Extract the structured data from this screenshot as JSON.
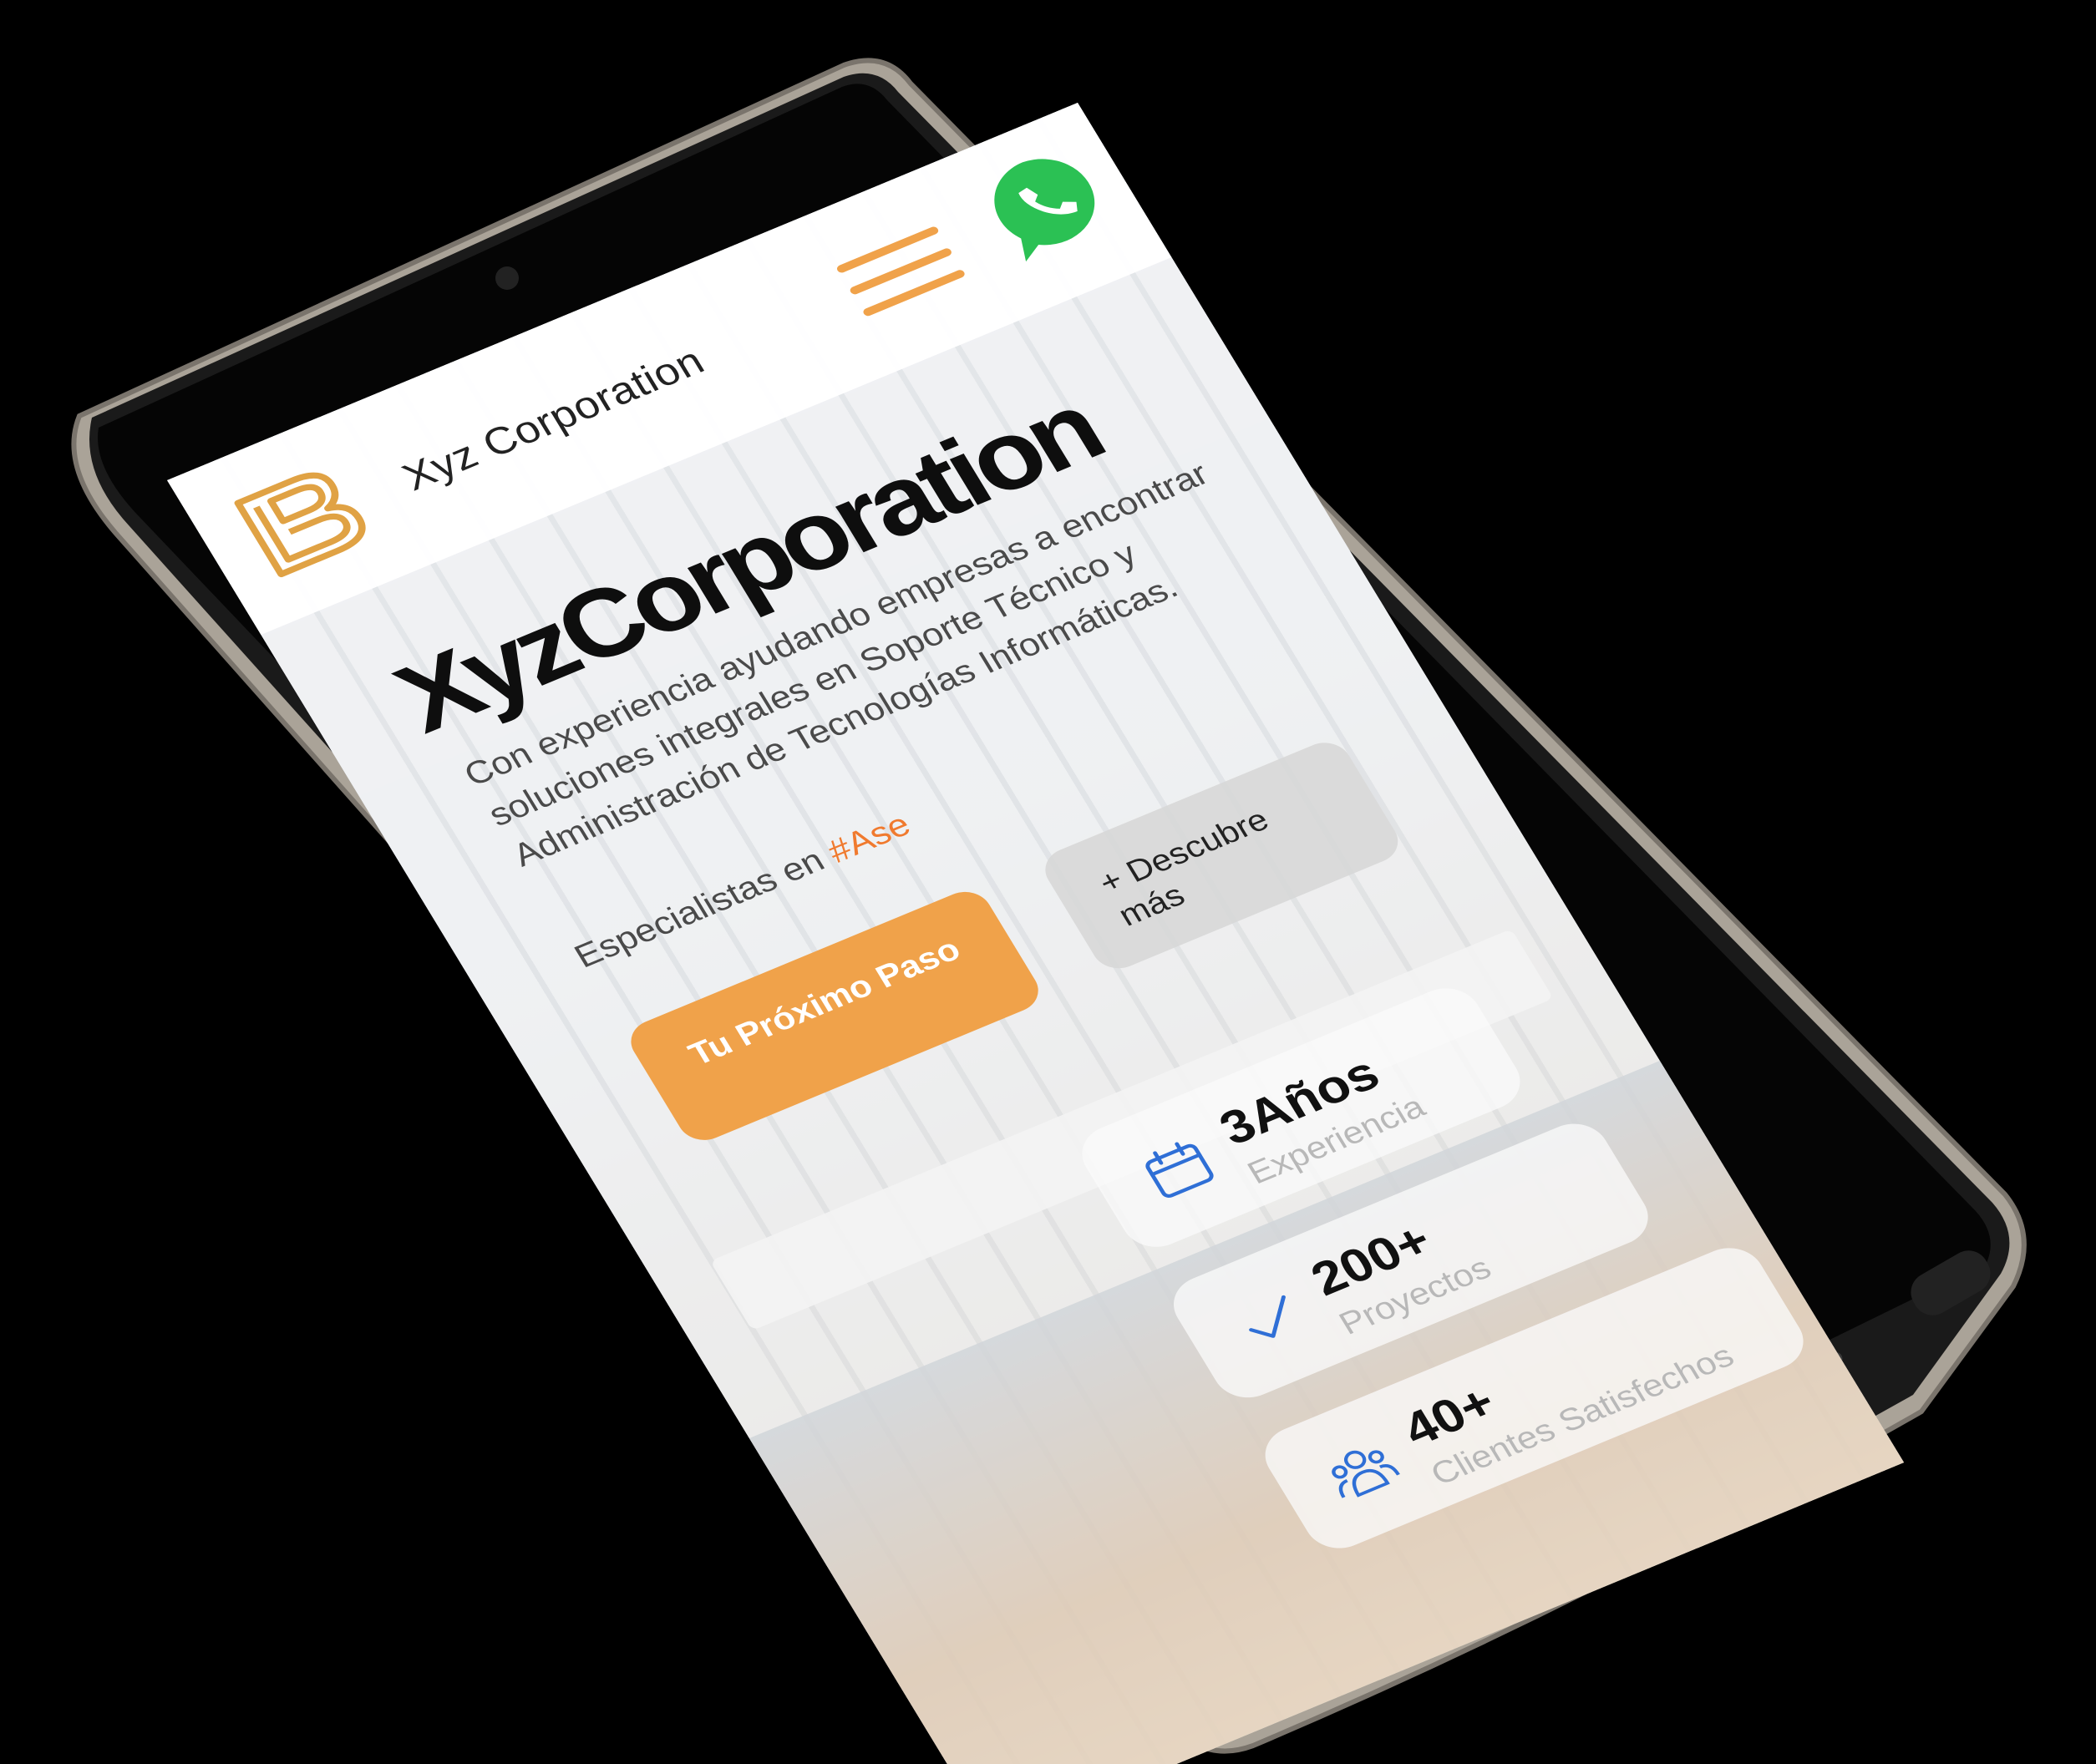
{
  "header": {
    "brand": "Xyz Corporation",
    "logo_icon": "logo-b-icon",
    "menu_icon": "hamburger-menu-icon",
    "whatsapp_icon": "whatsapp-icon"
  },
  "hero": {
    "title": "XyzCorporation",
    "description": "Con experiencia ayudando empresas a encontrar soluciones integrales en Soporte Técnico y Administración de Tecnologías Informáticas.",
    "tagline_prefix": "Especialistas en ",
    "tagline_hashtag": "#Ase",
    "primary_button": "Tu Próximo Paso",
    "secondary_button": "+ Descubre más"
  },
  "stats": [
    {
      "icon": "calendar-icon",
      "value": "3Años",
      "label": "Experiencia"
    },
    {
      "icon": "checkmark-icon",
      "value": "200+",
      "label": "Proyectos"
    },
    {
      "icon": "users-icon",
      "value": "40+",
      "label": "Clientes Satisfechos"
    }
  ],
  "colors": {
    "accent": "#f0a24a",
    "hashtag": "#f07a2e",
    "icon_blue": "#2f6fd6",
    "whatsapp": "#2bc154",
    "device_frame": "#a7a096"
  }
}
